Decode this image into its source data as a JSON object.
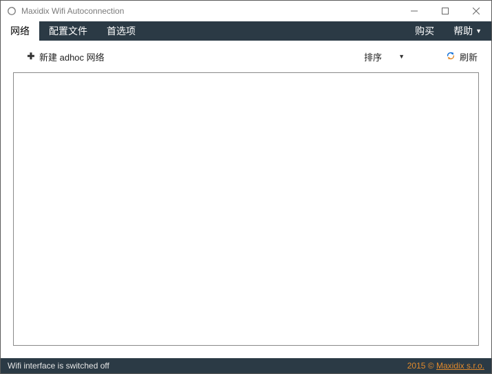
{
  "window": {
    "title": "Maxidix Wifi Autoconnection"
  },
  "menu": {
    "network": "网络",
    "profiles": "配置文件",
    "preferences": "首选项",
    "buy": "购买",
    "help": "帮助"
  },
  "toolbar": {
    "new_adhoc": "新建 adhoc 网络",
    "sort": "排序",
    "refresh": "刷新"
  },
  "status": {
    "message": "Wifi interface is switched off",
    "copyright_year": "2015 ©",
    "company": "Maxidix s.r.o."
  }
}
